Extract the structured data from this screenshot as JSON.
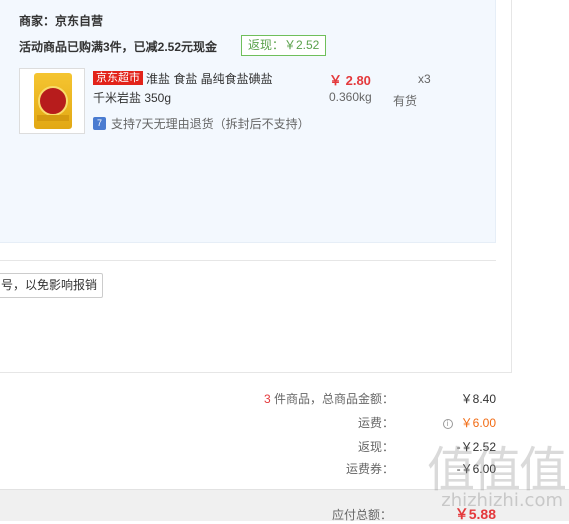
{
  "vendor": {
    "name": "商家：京东自营",
    "promo": "活动商品已购满3件，已减2.52元现金",
    "rebate_badge": "返现：￥2.52"
  },
  "product": {
    "tag": "京东超市",
    "title": "淮盐 食盐 晶纯食盐碘盐",
    "subtitle": "千米岩盐 350g",
    "price": "￥ 2.80",
    "weight": "0.360kg",
    "quantity": "x3",
    "stock": "有货",
    "return_icon": "7",
    "return_policy": "支持7天无理由退货（拆封后不支持）"
  },
  "hint": {
    "text": "号，以免影响报销"
  },
  "summary": {
    "count": "3",
    "count_label": "件商品，总商品金额：",
    "goods_total": "￥8.40",
    "shipping_label": "运费：",
    "shipping_icon": "i",
    "shipping_value": "￥6.00",
    "rebate_label": "返现：",
    "rebate_value": "-￥2.52",
    "coupon_label": "运费券：",
    "coupon_value": "-￥6.00",
    "total_label": "应付总额：",
    "total_value": "￥5.88"
  },
  "watermark": {
    "logo": "值值值",
    "url": "zhizhizhi.com"
  },
  "colors": {
    "accent_red": "#e4393c",
    "orange": "#f26b13",
    "rebate_green": "#5aa14b",
    "panel_bg": "#f3f8fe"
  }
}
